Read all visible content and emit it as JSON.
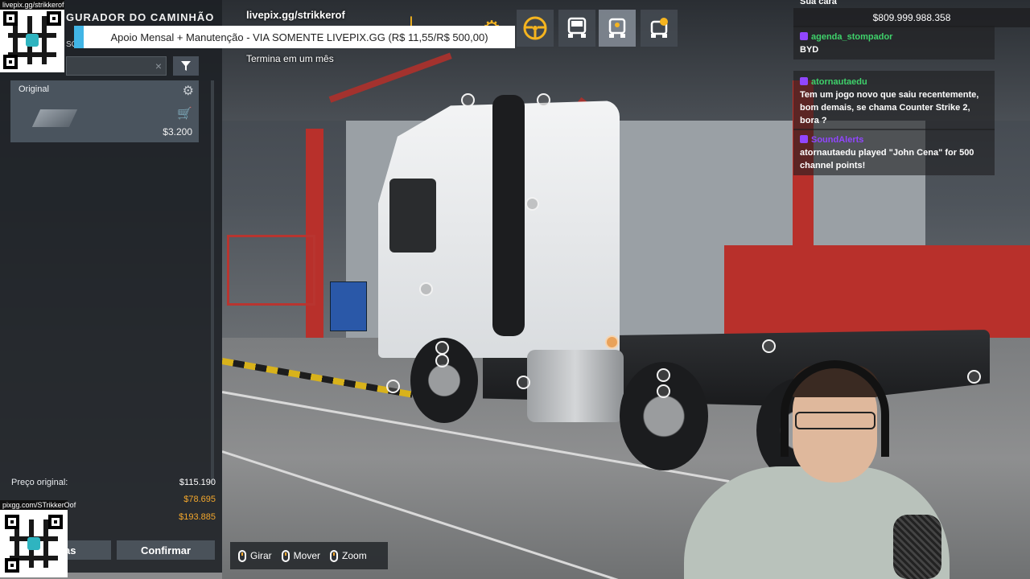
{
  "left_panel": {
    "title": "GURADOR DO CAMINHÃO",
    "subtitle": "SÓ",
    "search": {
      "value": "",
      "placeholder": ""
    },
    "item": {
      "label": "Original",
      "price": "$3.200"
    },
    "prices": [
      {
        "label": "Preço original:",
        "value": "$115.190",
        "accent": false
      },
      {
        "label": "",
        "value": "$78.695",
        "accent": true
      },
      {
        "label": "",
        "value": "$193.885",
        "accent": true
      }
    ],
    "buttons": {
      "changes": "anças",
      "confirm": "Confirmar"
    }
  },
  "qr": {
    "top_caption": "livepix.gg/strikkerof",
    "bottom_caption": "pixgg.com/STrikkerOof"
  },
  "livepix": {
    "url": "livepix.gg/strikkerof",
    "bar": "Apoio Mensal + Manutenção - VIA SOMENTE LIVEPIX.GG (R$ 11,55/R$ 500,00)",
    "sub": "Termina em um mês"
  },
  "toolbar": {
    "icons": [
      "chassis-icon",
      "axle-icon",
      "cabin-icon",
      "engine-icon",
      "steering-wheel-icon",
      "truck-front-icon",
      "truck-accessory-icon",
      "truck-paint-icon"
    ],
    "colors": {
      "accent": "#f5b41f"
    }
  },
  "chat": {
    "money_label": "Sua cara",
    "money": "$809.999.988.358",
    "messages": [
      {
        "user": "agenda_stompador",
        "user_color": "#3fd26b",
        "text": "BYD"
      },
      {
        "user": "atornautaedu",
        "user_color": "#3fd26b",
        "text": "Tem um jogo novo que saiu recentemente, bom demais, se chama Counter Strike 2, bora ?"
      },
      {
        "user": "SoundAlerts",
        "user_color": "#9146ff",
        "text": "atornautaedu played \"John Cena\" for 500 channel points!"
      }
    ]
  },
  "controls": [
    {
      "label": "Girar"
    },
    {
      "label": "Mover"
    },
    {
      "label": "Zoom"
    }
  ]
}
